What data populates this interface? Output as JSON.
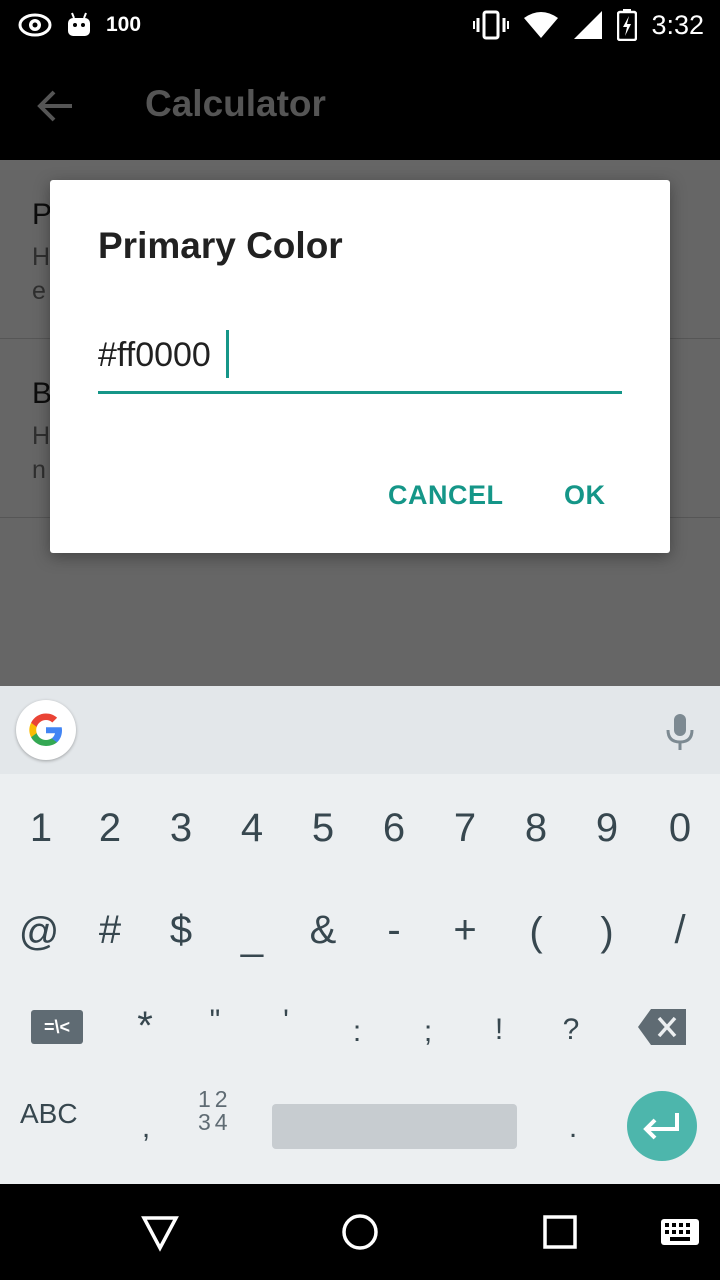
{
  "status_bar": {
    "battery_level_text": "100",
    "time": "3:32",
    "icons": [
      "eye-icon",
      "android-icon",
      "vibrate-icon",
      "wifi-icon",
      "signal-icon",
      "battery-charging-icon"
    ]
  },
  "toolbar": {
    "title": "Calculator",
    "back_icon": "arrow-back-icon"
  },
  "preferences": [
    {
      "title": "P",
      "summary_lines": [
        "H",
        "e"
      ]
    },
    {
      "title": "B",
      "summary_lines": [
        "H",
        "n"
      ]
    }
  ],
  "dialog": {
    "title": "Primary Color",
    "input_value": "#ff0000",
    "cancel_label": "CANCEL",
    "ok_label": "OK"
  },
  "keyboard": {
    "row1": [
      "1",
      "2",
      "3",
      "4",
      "5",
      "6",
      "7",
      "8",
      "9",
      "0"
    ],
    "row2": [
      "@",
      "#",
      "$",
      "_",
      "&",
      "-",
      "+",
      "(",
      ")",
      "/"
    ],
    "row3_symbols_key": "=\\<",
    "row3": [
      "*",
      "\"",
      "'",
      ":",
      ";",
      "!",
      "?"
    ],
    "abc_label": "ABC",
    "comma": ",",
    "num_label_top": "12",
    "num_label_bottom": "34",
    "period": "."
  },
  "colors": {
    "accent": "#159688",
    "enter_key": "#4db6ac",
    "scrim": "rgba(0,0,0,0.6)"
  }
}
